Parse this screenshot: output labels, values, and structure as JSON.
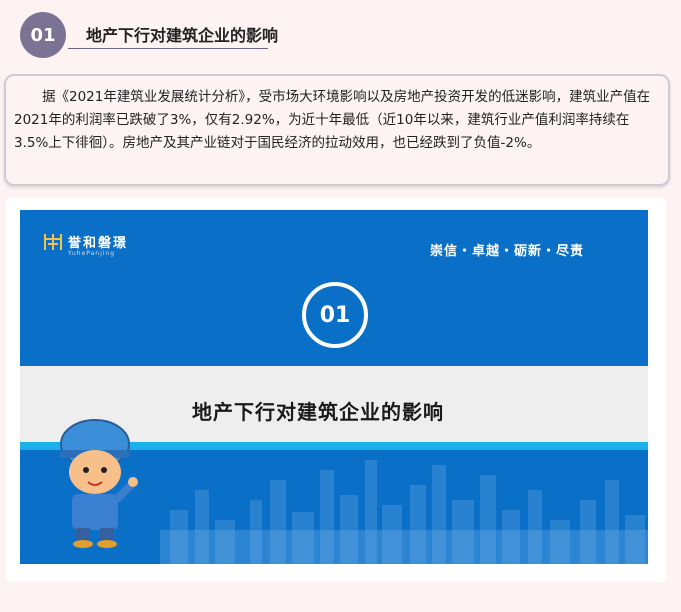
{
  "header": {
    "number": "01",
    "title": "地产下行对建筑企业的影响"
  },
  "paragraph": "据《2021年建筑业发展统计分析》，受市场大环境影响以及房地产投资开发的低迷影响，建筑业产值在2021年的利润率已跌破了3%，仅有2.92%，为近十年最低（近10年以来，建筑行业产值利润率持续在3.5%上下徘徊）。房地产及其产业链对于国民经济的拉动效用，也已经跌到了负值-2%。",
  "banner": {
    "logo_name": "誉和磐璟",
    "logo_sub": "YuhePanjing",
    "slogan": "崇信・卓越・砺新・尽责",
    "number": "01",
    "title": "地产下行对建筑企业的影响"
  },
  "colors": {
    "accent_purple": "#7b7393",
    "banner_blue": "#0a6fc6",
    "strip_cyan": "#1ab0ea"
  },
  "icons": [
    "logo-icon",
    "mascot-illustration",
    "city-skyline"
  ]
}
